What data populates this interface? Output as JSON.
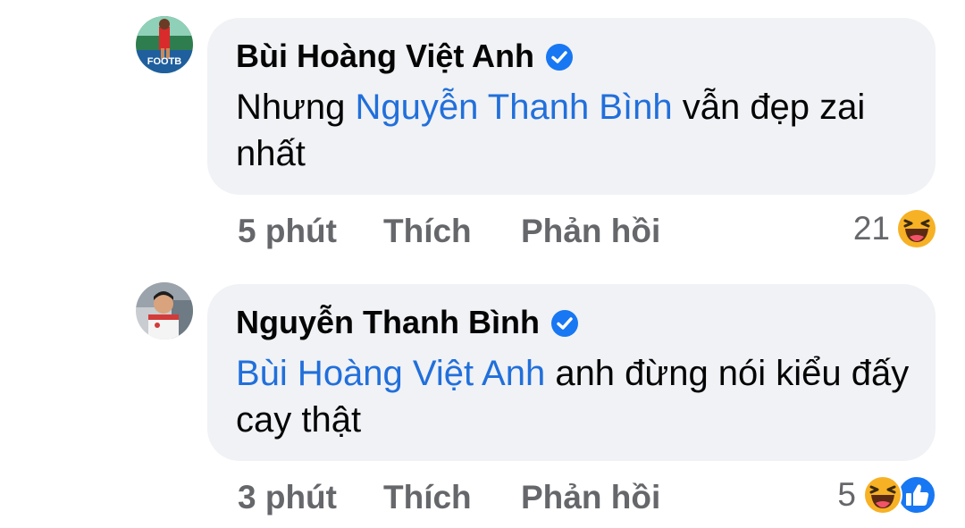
{
  "comments": [
    {
      "author": "Bùi Hoàng Việt Anh",
      "verified": true,
      "text_before": "Nhưng ",
      "mention": "Nguyễn Thanh Bình",
      "text_after": " vẫn đẹp zai nhất",
      "time": "5 phút",
      "like_label": "Thích",
      "reply_label": "Phản hồi",
      "reaction_count": "21",
      "reactions": [
        "haha-icon"
      ],
      "avatar_text": "FOOTB"
    },
    {
      "author": "Nguyễn Thanh Bình",
      "verified": true,
      "text_before": "",
      "mention": "Bùi Hoàng Việt Anh",
      "text_after": " anh đừng nói kiểu đấy cay thật",
      "time": "3 phút",
      "like_label": "Thích",
      "reply_label": "Phản hồi",
      "reaction_count": "5",
      "reactions": [
        "haha-icon",
        "like-icon"
      ]
    }
  ],
  "colors": {
    "bubble": "#f0f2f5",
    "mention": "#216fdb",
    "verified": "#1877f2",
    "meta_text": "#65676b",
    "haha": "#f7b125"
  }
}
